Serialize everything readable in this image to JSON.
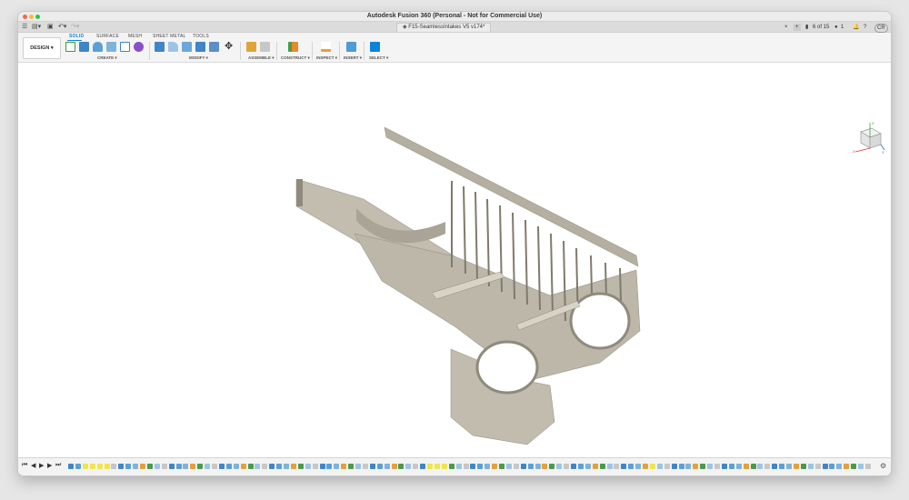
{
  "window": {
    "title": "Autodesk Fusion 360 (Personal - Not for Commercial Use)"
  },
  "tabbar": {
    "doc_tab": "F15-SeamlessIntakes V5 v174*",
    "job_status": "6 of 15",
    "online_count": "1",
    "user_initials": "CR"
  },
  "ribbon": {
    "design_label": "DESIGN ▾",
    "workspace_tabs": [
      "SOLID",
      "SURFACE",
      "MESH",
      "SHEET METAL",
      "TOOLS"
    ],
    "groups": [
      "CREATE ▾",
      "MODIFY ▾",
      "ASSEMBLE ▾",
      "CONSTRUCT ▾",
      "INSPECT ▾",
      "INSERT ▾",
      "SELECT ▾"
    ]
  },
  "viewcube": {
    "axes": [
      "Z",
      "X",
      "Y"
    ]
  },
  "colors": {
    "accent": "#0a84d8",
    "model": "#b8b3a4",
    "highlight": "#f2e54a"
  }
}
